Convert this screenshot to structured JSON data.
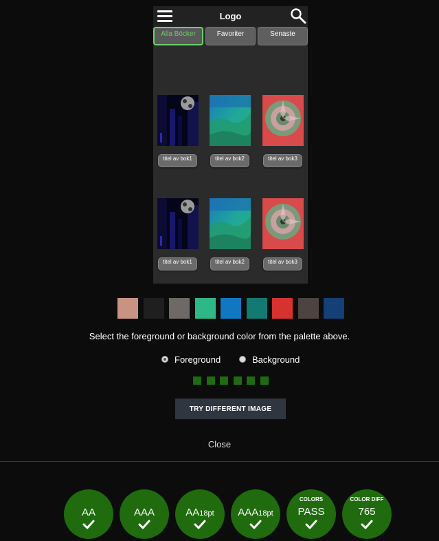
{
  "phone": {
    "logo": "Logo",
    "tabs": [
      {
        "label": "Alla Böcker",
        "active": true
      },
      {
        "label": "Favoriter",
        "active": false
      },
      {
        "label": "Senaste",
        "active": false
      }
    ],
    "books": [
      {
        "title": "titel av bok1"
      },
      {
        "title": "titel av bok2"
      },
      {
        "title": "titel av bok3"
      },
      {
        "title": "titel av bok1"
      },
      {
        "title": "titel av bok2"
      },
      {
        "title": "titel av bok3"
      }
    ]
  },
  "palette": [
    "#c99383",
    "#1f1f1f",
    "#6f6965",
    "#2db888",
    "#1277c1",
    "#127a72",
    "#d53230",
    "#4d4341",
    "#143f77"
  ],
  "instructions": "Select the foreground or background color from the palette above.",
  "radios": {
    "foreground": "Foreground",
    "background": "Background",
    "selected": "foreground"
  },
  "progress_count": 6,
  "try_button": "TRY DIFFERENT IMAGE",
  "close_label": "Close",
  "badges": [
    {
      "label": "AA",
      "sub": "",
      "small": ""
    },
    {
      "label": "AAA",
      "sub": "",
      "small": ""
    },
    {
      "label": "AA",
      "sub": "18pt",
      "small": ""
    },
    {
      "label": "AAA",
      "sub": "18pt",
      "small": ""
    },
    {
      "label": "PASS",
      "sub": "",
      "small": "COLORS"
    },
    {
      "label": "765",
      "sub": "",
      "small": "COLOR DIFF"
    }
  ],
  "colors": {
    "accent": "#6ccf6c",
    "badge": "#1f6b0e"
  }
}
